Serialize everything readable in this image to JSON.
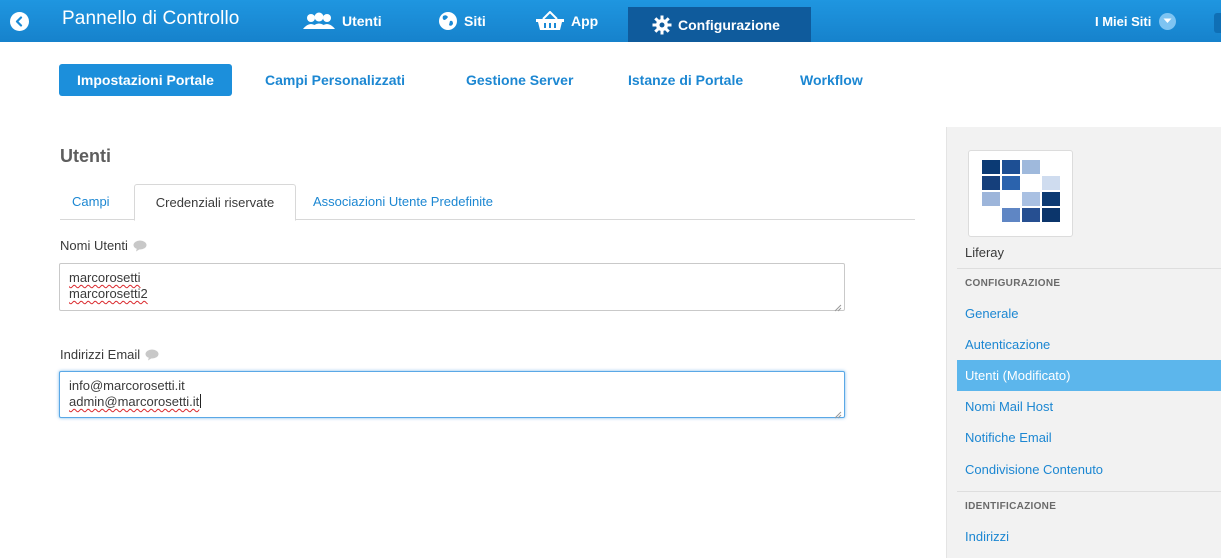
{
  "topbar": {
    "brand": "Pannello di Controllo",
    "nav": [
      {
        "label": "Utenti",
        "icon": "users-icon"
      },
      {
        "label": "Siti",
        "icon": "globe-icon"
      },
      {
        "label": "App",
        "icon": "shopping-basket-icon"
      },
      {
        "label": "Configurazione",
        "icon": "gear-icon"
      }
    ],
    "my_sites": "I Miei Siti",
    "colors": {
      "bar": "#1a8ad6",
      "active": "#0f5b9c"
    }
  },
  "subnav": {
    "items": [
      {
        "label": "Impostazioni Portale",
        "active": true
      },
      {
        "label": "Campi Personalizzati",
        "active": false
      },
      {
        "label": "Gestione Server",
        "active": false
      },
      {
        "label": "Istanze di Portale",
        "active": false
      },
      {
        "label": "Workflow",
        "active": false
      }
    ]
  },
  "main": {
    "title": "Utenti",
    "tabs": [
      {
        "label": "Campi",
        "active": false
      },
      {
        "label": "Credenziali riservate",
        "active": true
      },
      {
        "label": "Associazioni Utente Predefinite",
        "active": false
      }
    ],
    "fields": {
      "nomi_utenti": {
        "label": "Nomi Utenti",
        "lines": [
          "marcorosetti",
          "marcorosetti2"
        ]
      },
      "indirizzi_email": {
        "label": "Indirizzi Email",
        "lines": [
          "info@marcorosetti.it",
          "admin@marcorosetti.it"
        ]
      }
    }
  },
  "panel": {
    "logo_caption": "Liferay",
    "sections": [
      {
        "header": "CONFIGURAZIONE",
        "items": [
          {
            "label": "Generale",
            "active": false
          },
          {
            "label": "Autenticazione",
            "active": false
          },
          {
            "label": "Utenti (Modificato)",
            "active": true
          },
          {
            "label": "Nomi Mail Host",
            "active": false
          },
          {
            "label": "Notifiche Email",
            "active": false
          },
          {
            "label": "Condivisione Contenuto",
            "active": false
          }
        ]
      },
      {
        "header": "IDENTIFICAZIONE",
        "items": [
          {
            "label": "Indirizzi",
            "active": false
          }
        ]
      }
    ],
    "colors": {
      "active_item": "#5cb6ec",
      "link": "#1c87d2"
    }
  }
}
